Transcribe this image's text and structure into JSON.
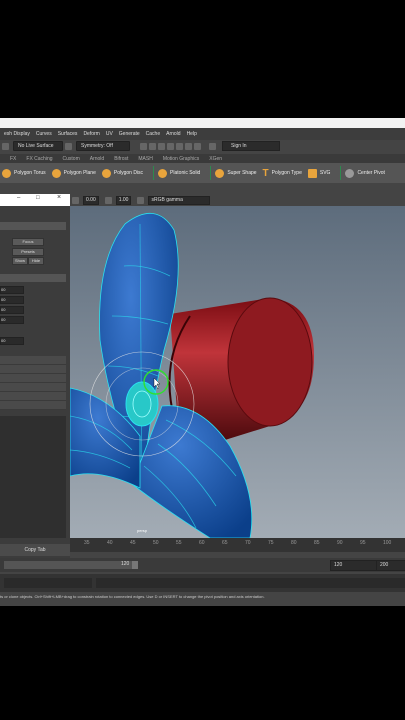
{
  "menu": [
    "esh Display",
    "Curves",
    "Surfaces",
    "Deform",
    "UV",
    "Generate",
    "Cache",
    "Arnold",
    "Help"
  ],
  "status": {
    "live_surface": "No Live Surface",
    "symmetry": "Symmetry: Off",
    "sign_in": "Sign In"
  },
  "shelf_tabs": [
    "FX",
    "FX Caching",
    "Custom",
    "Arnold",
    "Bifrost",
    "MASH",
    "Motion Graphics",
    "XGen"
  ],
  "shelf_items": [
    "Polygon Torus",
    "Polygon Plane",
    "Polygon Disc",
    "Platonic Solid",
    "Super Shape",
    "Polygon Type",
    "SVG",
    "Center Pivot"
  ],
  "panel": {
    "focus": "Focus",
    "presets": "Presets",
    "show": "Show",
    "hide": "Hide",
    "values": [
      "00",
      "00",
      "00",
      "00",
      "00"
    ],
    "copy_tab": "Copy Tab"
  },
  "viewport": {
    "field_a": "0.00",
    "field_b": "1.00",
    "color_space": "sRGB gamma",
    "camera": "persp"
  },
  "timeline": {
    "ticks": [
      "35",
      "40",
      "45",
      "50",
      "55",
      "60",
      "65",
      "70",
      "75",
      "80",
      "85",
      "90",
      "95",
      "100"
    ]
  },
  "range": {
    "current": "120",
    "end_a": "120",
    "end_b": "200"
  },
  "help_text": "ts or clone objects. Ctrl+Shift+LMB+drag to constrain rotation to connected edges. Use D or INSERT to change the pivot position and axis orientation."
}
